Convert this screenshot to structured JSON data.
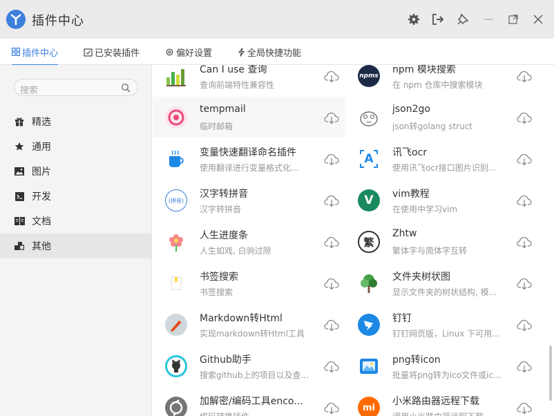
{
  "app": {
    "title": "插件中心",
    "accent": "#3c7fdc"
  },
  "tabs": [
    {
      "label": "插件中心",
      "icon": "grid-icon"
    },
    {
      "label": "已安装插件",
      "icon": "checklist-icon"
    },
    {
      "label": "偏好设置",
      "icon": "gear-icon"
    },
    {
      "label": "全局快捷功能",
      "icon": "lightning-icon"
    }
  ],
  "search": {
    "placeholder": "搜索"
  },
  "sidebar": {
    "items": [
      {
        "label": "精选",
        "icon": "gift-icon"
      },
      {
        "label": "通用",
        "icon": "star-icon"
      },
      {
        "label": "图片",
        "icon": "image-icon"
      },
      {
        "label": "开发",
        "icon": "terminal-icon"
      },
      {
        "label": "文档",
        "icon": "book-icon"
      },
      {
        "label": "其他",
        "icon": "blocks-icon"
      }
    ]
  },
  "plugins": [
    {
      "name": "Can I use 查询",
      "desc": "查询前端特性兼容性",
      "icon": "bar-chart-icon"
    },
    {
      "name": "npm 模块搜索",
      "desc": "在 npm 仓库中搜索模块",
      "icon": "npms-logo-icon",
      "icon_text": "npms"
    },
    {
      "name": "tempmail",
      "desc": "临时邮箱",
      "icon": "mail-icon"
    },
    {
      "name": "json2go",
      "desc": "json转golang struct",
      "icon": "gopher-icon"
    },
    {
      "name": "变量快速翻译命名插件",
      "desc": "使用翻译进行变量格式化...",
      "icon": "coffee-icon"
    },
    {
      "name": "讯飞ocr",
      "desc": "使用讯飞ocr接口图片识别...",
      "icon": "ocr-icon",
      "icon_text": "A"
    },
    {
      "name": "汉字转拼音",
      "desc": "汉字转拼音",
      "icon": "pinyin-icon",
      "icon_text": "(拼音)"
    },
    {
      "name": "vim教程",
      "desc": "在使用中学习vim",
      "icon": "vim-icon",
      "icon_text": "V"
    },
    {
      "name": "人生进度条",
      "desc": "人生如戏, 白驹过隙",
      "icon": "flower-icon"
    },
    {
      "name": "Zhtw",
      "desc": "繁体字与简体字互转",
      "icon": "traditional-char-icon",
      "icon_text": "繁"
    },
    {
      "name": "书签搜索",
      "desc": "书签搜索",
      "icon": "bookmark-icon"
    },
    {
      "name": "文件夹树状图",
      "desc": "显示文件夹的树状结构, 模...",
      "icon": "tree-icon"
    },
    {
      "name": "Markdown转Html",
      "desc": "实现markdown转Html工具",
      "icon": "pen-icon"
    },
    {
      "name": "钉钉",
      "desc": "钉钉网页版，Linux 下可用...",
      "icon": "dingtalk-icon"
    },
    {
      "name": "Github助手",
      "desc": "搜索github上的项目以及查...",
      "icon": "github-icon"
    },
    {
      "name": "png转icon",
      "desc": "批量将png转为ico文件或ic...",
      "icon": "picture-icon"
    },
    {
      "name": "加解密/编码工具enco...",
      "desc": "编码转换插件",
      "icon": "encode-icon"
    },
    {
      "name": "小米路由器远程下载",
      "desc": "调用小米路由器远程下载",
      "icon": "mi-icon",
      "icon_text": "mi"
    }
  ]
}
